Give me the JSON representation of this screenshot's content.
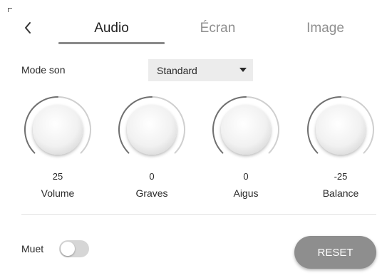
{
  "tabs": [
    {
      "label": "Audio",
      "active": true
    },
    {
      "label": "Écran",
      "active": false
    },
    {
      "label": "Image",
      "active": false
    }
  ],
  "mode_son": {
    "label": "Mode son",
    "selected": "Standard"
  },
  "knobs": [
    {
      "name": "Volume",
      "value": "25",
      "fraction": 0.5
    },
    {
      "name": "Graves",
      "value": "0",
      "fraction": 0.5
    },
    {
      "name": "Aigus",
      "value": "0",
      "fraction": 0.5
    },
    {
      "name": "Balance",
      "value": "-25",
      "fraction": 0.5
    }
  ],
  "mute": {
    "label": "Muet",
    "on": false
  },
  "reset_label": "RESET",
  "icons": {
    "back": "chevron-left-icon",
    "caret": "caret-down-icon"
  },
  "colors": {
    "tab_underline": "#8a8a8a",
    "select_bg": "#ececec",
    "reset_bg": "#8e8e8e",
    "toggle_off": "#d6d6d6"
  }
}
